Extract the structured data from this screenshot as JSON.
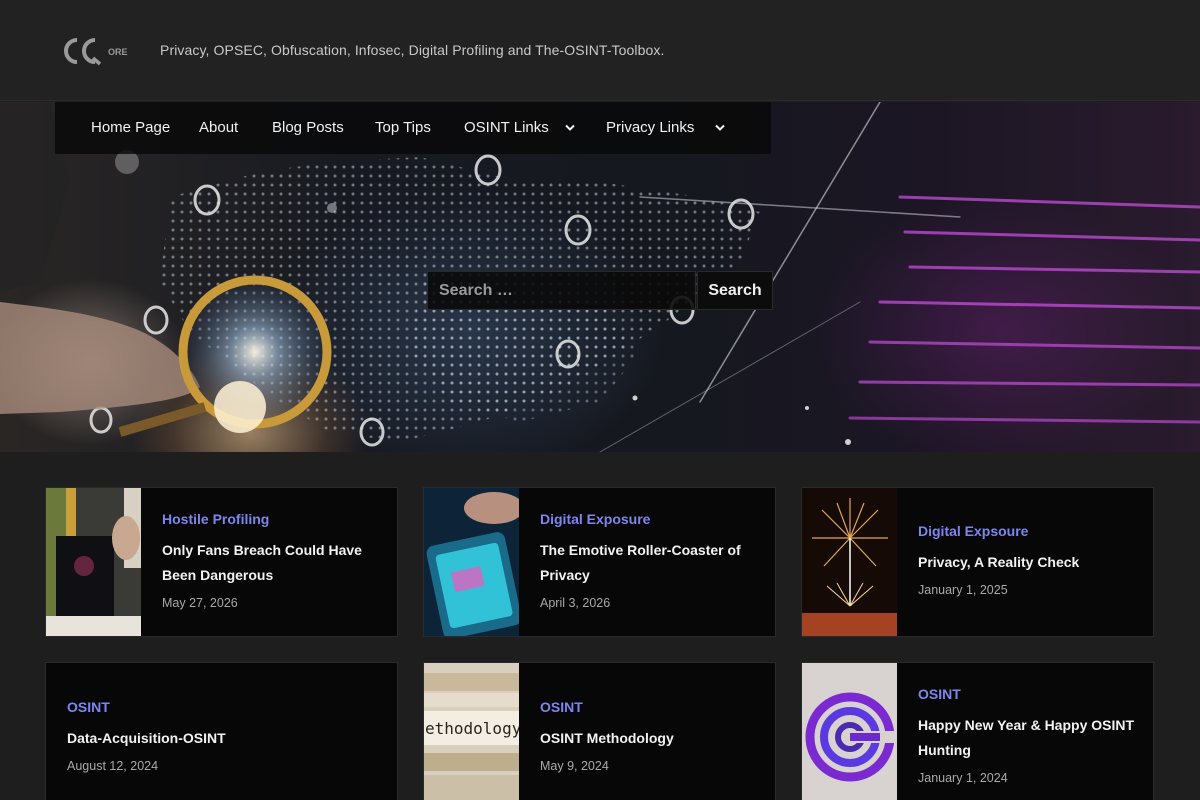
{
  "header": {
    "logo_text": "CQCore",
    "tagline": "Privacy, OPSEC, Obfuscation, Infosec, Digital Profiling and The-OSINT-Toolbox."
  },
  "nav": {
    "items": [
      {
        "label": "Home Page"
      },
      {
        "label": "About"
      },
      {
        "label": "Blog Posts"
      },
      {
        "label": "Top Tips"
      },
      {
        "label": "OSINT Links",
        "has_submenu": true
      },
      {
        "label": "Privacy Links",
        "has_submenu": true
      }
    ]
  },
  "search": {
    "placeholder": "Search …",
    "button_label": "Search"
  },
  "posts": [
    {
      "category": "Hostile Profiling",
      "title": "Only Fans Breach Could Have Been Dangerous",
      "date": "May 27, 2026",
      "thumbnail": "office-screen-photo"
    },
    {
      "category": "Digital Exposure",
      "title": "The Emotive Roller-Coaster of Privacy",
      "date": "April 3, 2026",
      "thumbnail": "glowing-phone-photo"
    },
    {
      "category": "Digital Expsoure",
      "title": "Privacy, A Reality Check",
      "date": "January 1, 2025",
      "thumbnail": "fireworks-photo"
    },
    {
      "category": "OSINT",
      "title": "Data-Acquisition-OSINT",
      "date": "August 12, 2024",
      "thumbnail": null
    },
    {
      "category": "OSINT",
      "title": "OSINT Methodology",
      "date": "May 9, 2024",
      "thumbnail": "methodology-file-photo",
      "thumbnail_text": "ethodology"
    },
    {
      "category": "OSINT",
      "title": "Happy New Year & Happy OSINT Hunting",
      "date": "January 1, 2024",
      "thumbnail": "cq-logo-graphic"
    }
  ],
  "colors": {
    "page_bg": "#1e1e1e",
    "header_bg": "#222222",
    "card_bg": "#070707",
    "category": "#7d86f0",
    "accent_magenta": "#c040e0"
  }
}
